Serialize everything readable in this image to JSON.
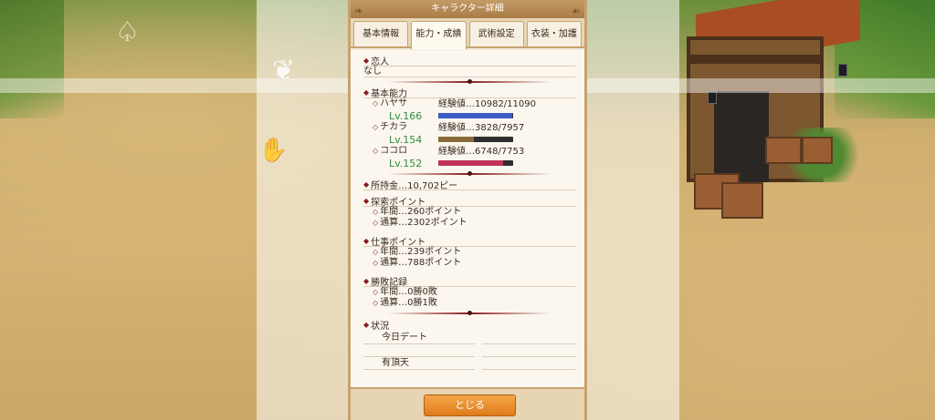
{
  "header": {
    "title": "キャラクター詳細"
  },
  "tabs": [
    {
      "label": "基本情報",
      "active": false
    },
    {
      "label": "能力・成績",
      "active": true
    },
    {
      "label": "武術設定",
      "active": false
    },
    {
      "label": "衣装・加護",
      "active": false
    }
  ],
  "lover": {
    "title": "恋人",
    "value": "なし"
  },
  "abilities": {
    "title": "基本能力",
    "items": [
      {
        "name": "ハヤサ",
        "level": "Lv.166",
        "exp": "経験値…10982/11090",
        "fill": 0.99,
        "color": "#3b5cc4"
      },
      {
        "name": "チカラ",
        "level": "Lv.154",
        "exp": "経験値…3828/7957",
        "fill": 0.48,
        "color": "#8a6a3a"
      },
      {
        "name": "ココロ",
        "level": "Lv.152",
        "exp": "経験値…6748/7753",
        "fill": 0.87,
        "color": "#c2335a"
      }
    ]
  },
  "money": {
    "title": "所持金…10,702ピー"
  },
  "explore": {
    "title": "探索ポイント",
    "yearly": "年間…260ポイント",
    "total": "通算…2302ポイント"
  },
  "work": {
    "title": "仕事ポイント",
    "yearly": "年間…239ポイント",
    "total": "通算…788ポイント"
  },
  "record": {
    "title": "勝敗記録",
    "yearly": "年間…0勝0敗",
    "total": "通算…0勝1敗"
  },
  "status": {
    "title": "状況",
    "items": [
      "今日デート",
      "有頂天"
    ]
  },
  "footer": {
    "close_label": "とじる"
  }
}
